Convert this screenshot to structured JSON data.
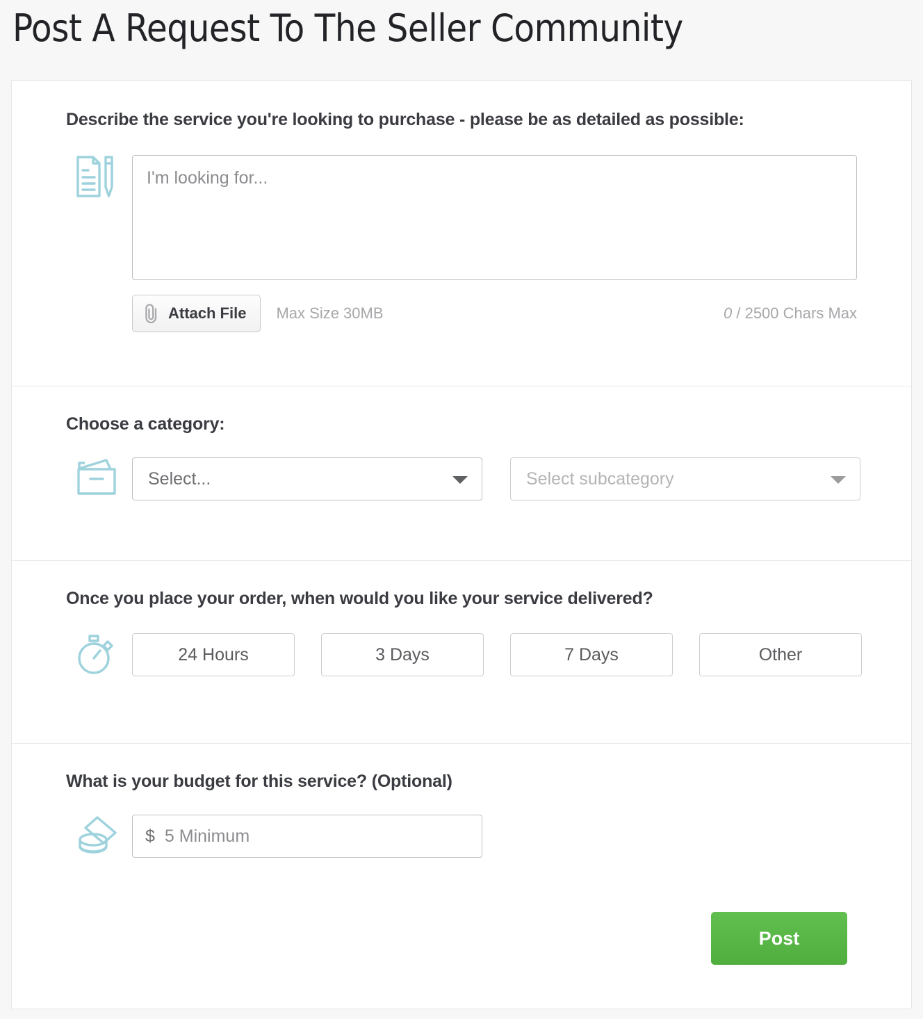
{
  "page": {
    "title": "Post A Request To The Seller Community",
    "accent_green": "#55b845",
    "accent_teal": "#9ed2dd",
    "background": "#f7f7f7"
  },
  "describe": {
    "label": "Describe the service you're looking to purchase - please be as detailed as possible:",
    "icon": "document-pencil-icon",
    "textarea_placeholder": "I'm looking for...",
    "textarea_value": "",
    "attach_label": "Attach File",
    "attach_icon": "paperclip-icon",
    "max_size": "Max Size 30MB",
    "chars_count": "0",
    "chars_suffix": " / 2500 Chars Max"
  },
  "category": {
    "label": "Choose a category:",
    "icon": "folder-icon",
    "category_select": "Select...",
    "subcategory_select": "Select subcategory"
  },
  "delivery": {
    "label": "Once you place your order, when would you like your service delivered?",
    "icon": "stopwatch-icon",
    "options": [
      {
        "label": "24 Hours"
      },
      {
        "label": "3 Days"
      },
      {
        "label": "7 Days"
      },
      {
        "label": "Other"
      }
    ]
  },
  "budget": {
    "label": "What is your budget for this service? (Optional)",
    "icon": "money-stack-icon",
    "currency_sign": "$",
    "amount_placeholder": "5 Minimum",
    "amount_value": ""
  },
  "submit": {
    "post_label": "Post"
  }
}
